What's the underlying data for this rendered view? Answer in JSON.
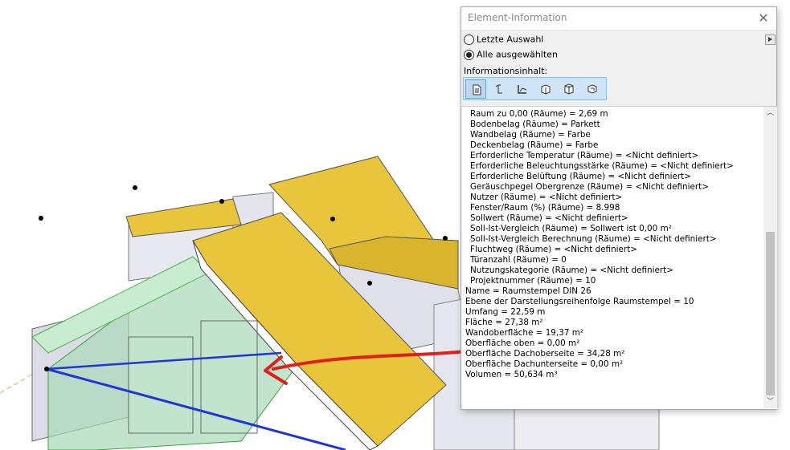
{
  "window": {
    "title": "Element-Information",
    "close_icon": "close-icon"
  },
  "selection": {
    "option_last": "Letzte Auswahl",
    "option_all": "Alle ausgewählten",
    "selected": "Alle ausgewählten"
  },
  "content_label": "Informationsinhalt:",
  "toolbar_icons": [
    "document-icon",
    "element-icon",
    "stair-icon",
    "box-icon",
    "box-back-icon",
    "box-rotate-icon"
  ],
  "info_lines": [
    {
      "text": "Raum zu 0,00 (Räume) = 2,69 m",
      "indent": true
    },
    {
      "text": "Bodenbelag (Räume) = Parkett",
      "indent": true
    },
    {
      "text": "Wandbelag (Räume) = Farbe",
      "indent": true
    },
    {
      "text": "Deckenbelag (Räume) = Farbe",
      "indent": true
    },
    {
      "text": "Erforderliche Temperatur (Räume) = <Nicht definiert>",
      "indent": true
    },
    {
      "text": "Erforderliche Beleuchtungsstärke (Räume) = <Nicht definiert>",
      "indent": true
    },
    {
      "text": "Erforderliche Belüftung (Räume) = <Nicht definiert>",
      "indent": true
    },
    {
      "text": "Geräuschpegel Obergrenze (Räume) = <Nicht definiert>",
      "indent": true
    },
    {
      "text": "Nutzer (Räume) = <Nicht definiert>",
      "indent": true
    },
    {
      "text": "Fenster/Raum (%) (Räume) = 8.998",
      "indent": true
    },
    {
      "text": "Sollwert (Räume) = <Nicht definiert>",
      "indent": true
    },
    {
      "text": "Soll-Ist-Vergleich (Räume) = Sollwert ist 0,00 m²",
      "indent": true
    },
    {
      "text": "Soll-Ist-Vergleich Berechnung (Räume) = <Nicht definiert>",
      "indent": true
    },
    {
      "text": "Fluchtweg (Räume) = <Nicht definiert>",
      "indent": true
    },
    {
      "text": "Türanzahl (Räume) = 0",
      "indent": true
    },
    {
      "text": "Nutzungskategorie (Räume) = <Nicht definiert>",
      "indent": true
    },
    {
      "text": "Projektnummer (Räume) = 10",
      "indent": true
    },
    {
      "text": "Name = Raumstempel DIN 26",
      "indent": false
    },
    {
      "text": "Ebene der Darstellungsreihenfolge Raumstempel = 10",
      "indent": false
    },
    {
      "text": "Umfang = 22,59 m",
      "indent": false
    },
    {
      "text": "Fläche = 27,38 m²",
      "indent": false
    },
    {
      "text": "Wandoberfläche = 19,37 m²",
      "indent": false
    },
    {
      "text": "Oberfläche oben = 0,00 m²",
      "indent": false
    },
    {
      "text": "Oberfläche Dachoberseite = 34,28 m²",
      "indent": false
    },
    {
      "text": "Oberfläche Dachunterseite = 0,00 m²",
      "indent": false
    },
    {
      "text": "Volumen = 50,634 m³",
      "indent": false
    }
  ],
  "colors": {
    "roof": "#e8c53a",
    "room_fill": "#a8d8b8",
    "annotation_arrow": "#e0201c",
    "edge_blue": "#1f35d6"
  }
}
